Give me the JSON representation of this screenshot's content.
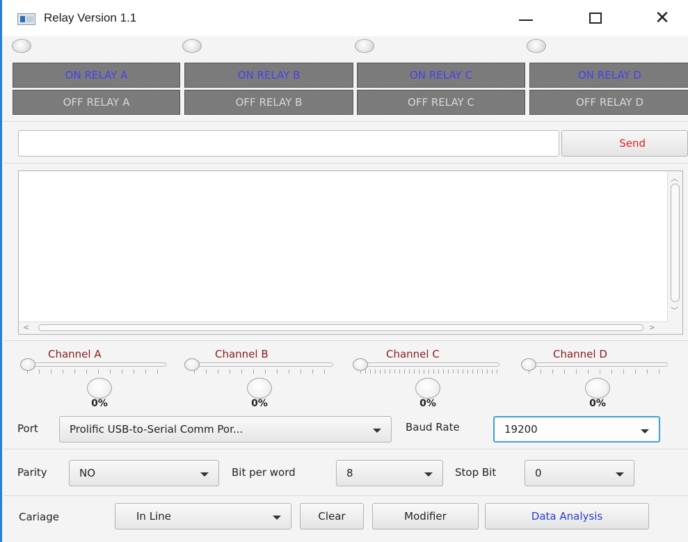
{
  "window": {
    "title": "Relay Version 1.1"
  },
  "relays": {
    "on_buttons": [
      "ON RELAY A",
      "ON RELAY B",
      "ON RELAY C",
      "ON RELAY D"
    ],
    "off_buttons": [
      "OFF RELAY A",
      "OFF RELAY B",
      "OFF RELAY C",
      "OFF RELAY D"
    ]
  },
  "command": {
    "input_value": "",
    "send_label": "Send"
  },
  "log": {
    "content": ""
  },
  "channels": [
    {
      "label": "Channel A",
      "percent": "0%",
      "level": 0
    },
    {
      "label": "Channel B",
      "percent": "0%",
      "level": 0
    },
    {
      "label": "Channel C",
      "percent": "0%",
      "level": 0
    },
    {
      "label": "Channel D",
      "percent": "0%",
      "level": 0
    }
  ],
  "serial": {
    "port_label": "Port",
    "port_value": "Prolific USB-to-Serial Comm Por...",
    "baud_label": "Baud Rate",
    "baud_value": "19200",
    "parity_label": "Parity",
    "parity_value": "NO",
    "bits_label": "Bit per word",
    "bits_value": "8",
    "stop_label": "Stop Bit",
    "stop_value": "0"
  },
  "footer": {
    "cariage_label": "Cariage",
    "cariage_value": "In Line",
    "clear_label": "Clear",
    "modifier_label": "Modifier",
    "analysis_label": "Data Analysis"
  },
  "colors": {
    "on_text": "#4a3ef0",
    "off_text": "#d8d8d8",
    "send_text": "#e02020",
    "channel_text": "#8b1a1a",
    "analysis_text": "#2a3ad0",
    "focus_border": "#3ea0d6"
  },
  "icons": [
    "app-icon",
    "minimize-icon",
    "maximize-icon",
    "close-icon",
    "dropdown-arrow-icon"
  ]
}
